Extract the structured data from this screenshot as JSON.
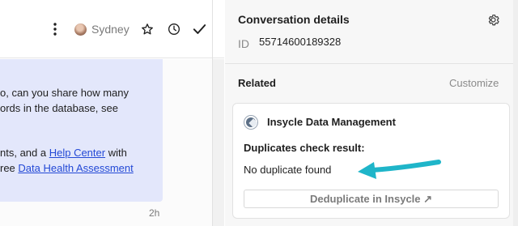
{
  "toolbar": {
    "more_icon": "more-vertical-icon",
    "assignee_name": "Sydney",
    "star_icon": "star-icon",
    "snooze_icon": "clock-icon",
    "close_icon": "check-icon"
  },
  "conversation": {
    "message_lines": [
      "o, can you share how many",
      "ords in the database, see",
      "nts, and a ",
      "ree "
    ],
    "link_help_center": "Help Center",
    "after_help_center": " with",
    "link_data_health": "Data Health Assessment",
    "timestamp": "2h"
  },
  "details_panel": {
    "title": "Conversation details",
    "id_label": "ID",
    "id_value": "55714600189328",
    "related_label": "Related",
    "customize_label": "Customize"
  },
  "app_card": {
    "app_name": "Insycle Data Management",
    "check_label": "Duplicates check result:",
    "check_result": "No duplicate found",
    "button_label": "Deduplicate in Insycle ↗"
  },
  "colors": {
    "bubble": "#e3e7fb",
    "link": "#2349d6",
    "annotation_arrow": "#1fb5c9"
  }
}
